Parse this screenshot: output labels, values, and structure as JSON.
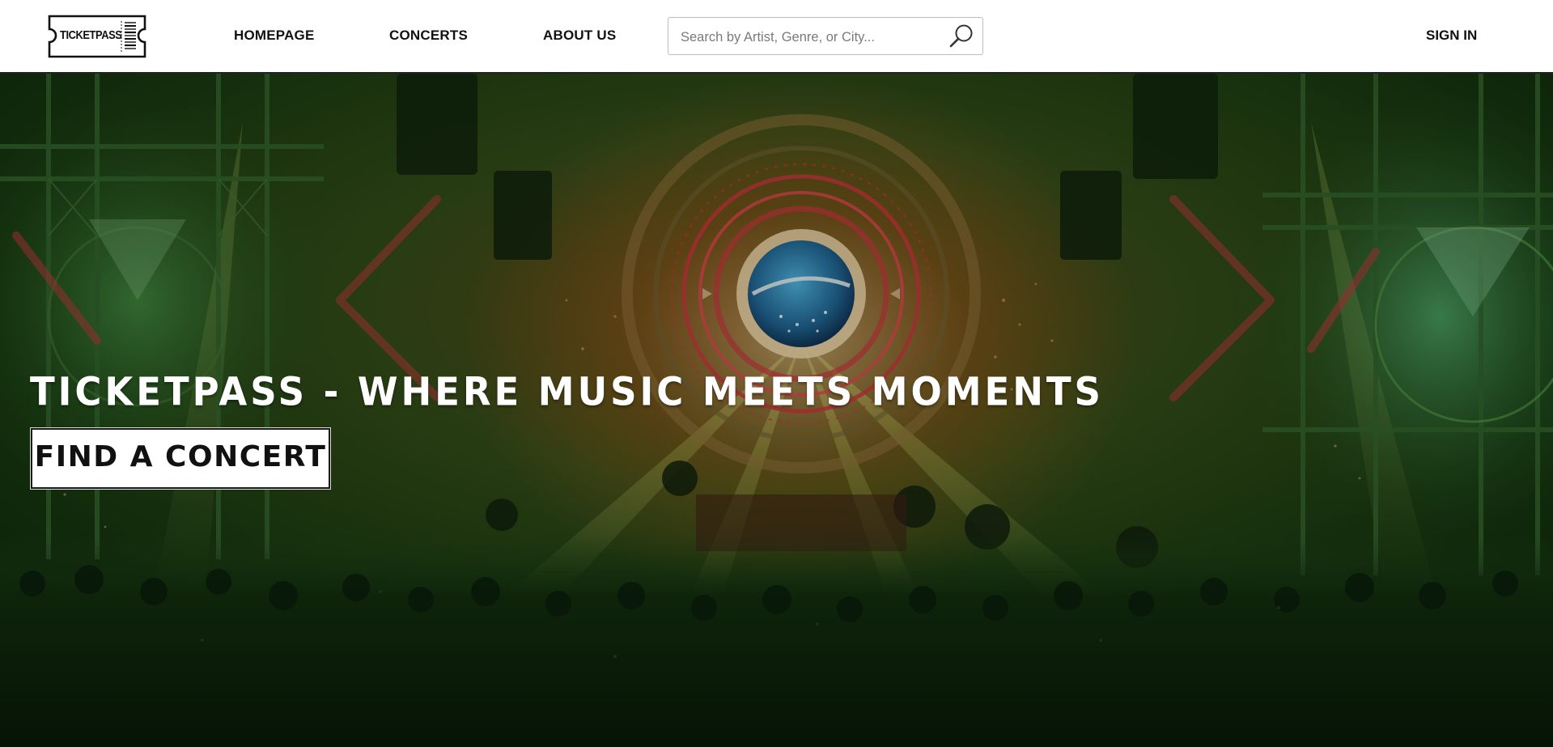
{
  "brand": {
    "logo_text": "TICKETPASS"
  },
  "nav": {
    "items": [
      {
        "label": "HOMEPAGE"
      },
      {
        "label": "CONCERTS"
      },
      {
        "label": "ABOUT US"
      }
    ]
  },
  "search": {
    "placeholder": "Search by Artist, Genre, or City...",
    "value": "",
    "icon": "search-icon"
  },
  "account": {
    "signin_label": "SIGN IN"
  },
  "hero": {
    "title": "TICKETPASS - WHERE MUSIC MEETS MOMENTS",
    "cta_label": "FIND A CONCERT",
    "background": "concert-stage-photo"
  },
  "colors": {
    "header_bg": "#ffffff",
    "text_dark": "#111111",
    "hero_tint": "#1c3a12",
    "hero_text": "#ffffff",
    "stage_red": "#c0303a"
  }
}
